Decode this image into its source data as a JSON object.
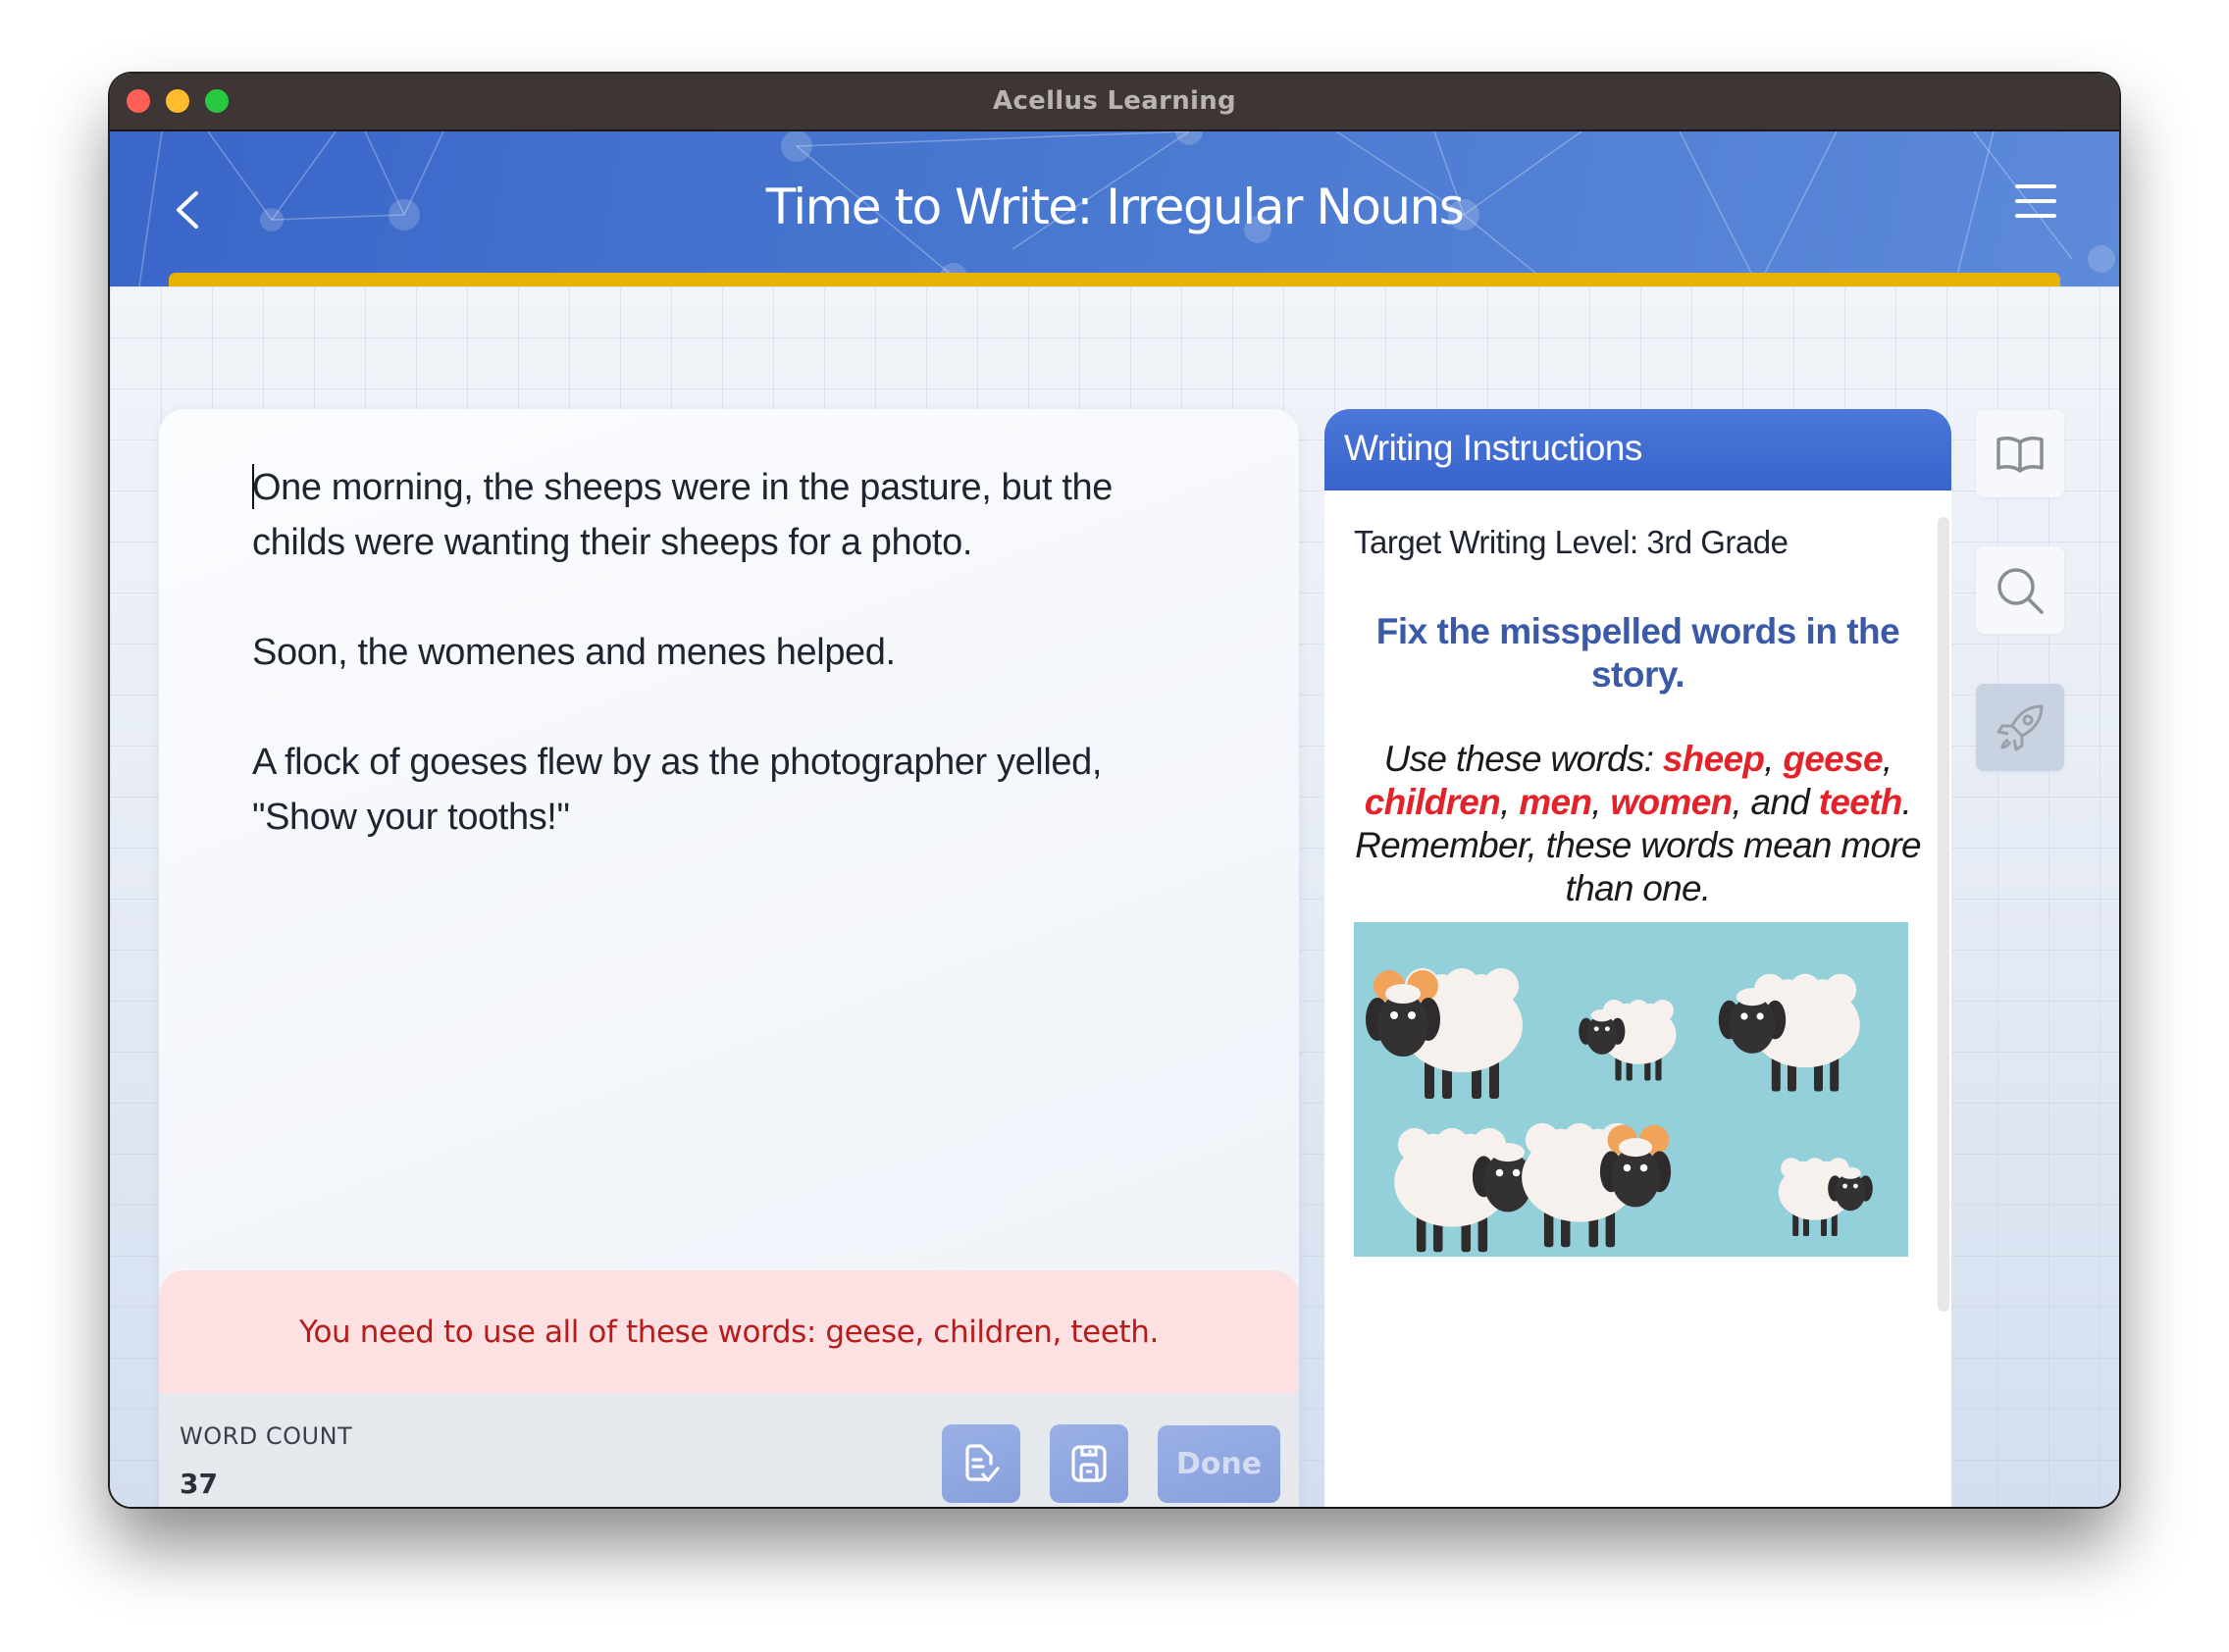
{
  "window": {
    "title": "Acellus Learning"
  },
  "header": {
    "title": "Time to Write: Irregular Nouns",
    "back_icon": "chevron-left-icon",
    "menu_icon": "hamburger-menu-icon",
    "progress_percent": 100,
    "progress_color": "#e8b208",
    "accent_color": "#3f6dcd"
  },
  "editor": {
    "paragraphs": [
      "One morning, the sheeps were in the pasture, but the childs were wanting their sheeps for a photo.",
      "Soon, the womenes and menes helped.",
      "A flock of goeses flew by as the photographer yelled, \"Show your tooths!\""
    ],
    "alert": {
      "text": "You need to use all of these words: geese, children, teeth.",
      "color": "#b71c1c",
      "background": "#fde1e2"
    },
    "footer": {
      "word_count_label": "WORD COUNT",
      "word_count_value": "37",
      "check_button_icon": "document-check-icon",
      "save_button_icon": "floppy-disk-icon",
      "done_label": "Done"
    }
  },
  "instructions": {
    "title": "Writing Instructions",
    "target_level": "Target Writing Level: 3rd Grade",
    "heading": "Fix the misspelled words in the story.",
    "words_intro": "Use these words: ",
    "keywords": [
      "sheep",
      "geese",
      "children",
      "men",
      "women",
      "teeth"
    ],
    "separators": [
      ", ",
      ", ",
      ", ",
      ", ",
      ", and ",
      ""
    ],
    "words_outro": ".  Remember, these words mean more than one.",
    "keyword_color": "#e3222a",
    "image_alt": "Cartoon illustration of sheep and rams on a teal background"
  },
  "side_tools": [
    {
      "name": "book",
      "icon": "open-book-icon"
    },
    {
      "name": "search",
      "icon": "magnifier-icon"
    },
    {
      "name": "rocket",
      "icon": "rocket-icon",
      "disabled": true
    }
  ]
}
